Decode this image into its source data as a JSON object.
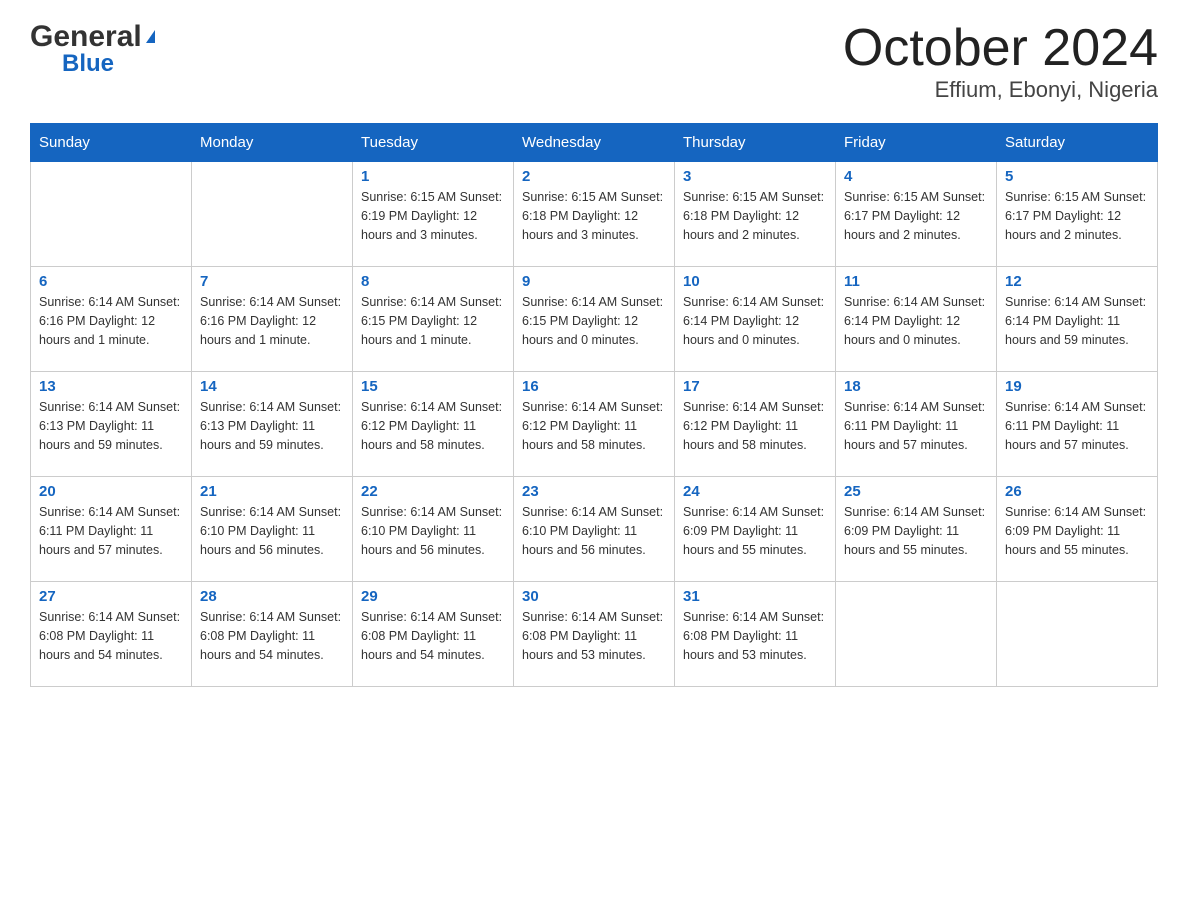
{
  "header": {
    "logo_general": "General",
    "logo_arrow": "▶",
    "logo_blue": "Blue",
    "month_title": "October 2024",
    "location": "Effium, Ebonyi, Nigeria"
  },
  "days_of_week": [
    "Sunday",
    "Monday",
    "Tuesday",
    "Wednesday",
    "Thursday",
    "Friday",
    "Saturday"
  ],
  "weeks": [
    [
      {
        "day": "",
        "info": ""
      },
      {
        "day": "",
        "info": ""
      },
      {
        "day": "1",
        "info": "Sunrise: 6:15 AM\nSunset: 6:19 PM\nDaylight: 12 hours\nand 3 minutes."
      },
      {
        "day": "2",
        "info": "Sunrise: 6:15 AM\nSunset: 6:18 PM\nDaylight: 12 hours\nand 3 minutes."
      },
      {
        "day": "3",
        "info": "Sunrise: 6:15 AM\nSunset: 6:18 PM\nDaylight: 12 hours\nand 2 minutes."
      },
      {
        "day": "4",
        "info": "Sunrise: 6:15 AM\nSunset: 6:17 PM\nDaylight: 12 hours\nand 2 minutes."
      },
      {
        "day": "5",
        "info": "Sunrise: 6:15 AM\nSunset: 6:17 PM\nDaylight: 12 hours\nand 2 minutes."
      }
    ],
    [
      {
        "day": "6",
        "info": "Sunrise: 6:14 AM\nSunset: 6:16 PM\nDaylight: 12 hours\nand 1 minute."
      },
      {
        "day": "7",
        "info": "Sunrise: 6:14 AM\nSunset: 6:16 PM\nDaylight: 12 hours\nand 1 minute."
      },
      {
        "day": "8",
        "info": "Sunrise: 6:14 AM\nSunset: 6:15 PM\nDaylight: 12 hours\nand 1 minute."
      },
      {
        "day": "9",
        "info": "Sunrise: 6:14 AM\nSunset: 6:15 PM\nDaylight: 12 hours\nand 0 minutes."
      },
      {
        "day": "10",
        "info": "Sunrise: 6:14 AM\nSunset: 6:14 PM\nDaylight: 12 hours\nand 0 minutes."
      },
      {
        "day": "11",
        "info": "Sunrise: 6:14 AM\nSunset: 6:14 PM\nDaylight: 12 hours\nand 0 minutes."
      },
      {
        "day": "12",
        "info": "Sunrise: 6:14 AM\nSunset: 6:14 PM\nDaylight: 11 hours\nand 59 minutes."
      }
    ],
    [
      {
        "day": "13",
        "info": "Sunrise: 6:14 AM\nSunset: 6:13 PM\nDaylight: 11 hours\nand 59 minutes."
      },
      {
        "day": "14",
        "info": "Sunrise: 6:14 AM\nSunset: 6:13 PM\nDaylight: 11 hours\nand 59 minutes."
      },
      {
        "day": "15",
        "info": "Sunrise: 6:14 AM\nSunset: 6:12 PM\nDaylight: 11 hours\nand 58 minutes."
      },
      {
        "day": "16",
        "info": "Sunrise: 6:14 AM\nSunset: 6:12 PM\nDaylight: 11 hours\nand 58 minutes."
      },
      {
        "day": "17",
        "info": "Sunrise: 6:14 AM\nSunset: 6:12 PM\nDaylight: 11 hours\nand 58 minutes."
      },
      {
        "day": "18",
        "info": "Sunrise: 6:14 AM\nSunset: 6:11 PM\nDaylight: 11 hours\nand 57 minutes."
      },
      {
        "day": "19",
        "info": "Sunrise: 6:14 AM\nSunset: 6:11 PM\nDaylight: 11 hours\nand 57 minutes."
      }
    ],
    [
      {
        "day": "20",
        "info": "Sunrise: 6:14 AM\nSunset: 6:11 PM\nDaylight: 11 hours\nand 57 minutes."
      },
      {
        "day": "21",
        "info": "Sunrise: 6:14 AM\nSunset: 6:10 PM\nDaylight: 11 hours\nand 56 minutes."
      },
      {
        "day": "22",
        "info": "Sunrise: 6:14 AM\nSunset: 6:10 PM\nDaylight: 11 hours\nand 56 minutes."
      },
      {
        "day": "23",
        "info": "Sunrise: 6:14 AM\nSunset: 6:10 PM\nDaylight: 11 hours\nand 56 minutes."
      },
      {
        "day": "24",
        "info": "Sunrise: 6:14 AM\nSunset: 6:09 PM\nDaylight: 11 hours\nand 55 minutes."
      },
      {
        "day": "25",
        "info": "Sunrise: 6:14 AM\nSunset: 6:09 PM\nDaylight: 11 hours\nand 55 minutes."
      },
      {
        "day": "26",
        "info": "Sunrise: 6:14 AM\nSunset: 6:09 PM\nDaylight: 11 hours\nand 55 minutes."
      }
    ],
    [
      {
        "day": "27",
        "info": "Sunrise: 6:14 AM\nSunset: 6:08 PM\nDaylight: 11 hours\nand 54 minutes."
      },
      {
        "day": "28",
        "info": "Sunrise: 6:14 AM\nSunset: 6:08 PM\nDaylight: 11 hours\nand 54 minutes."
      },
      {
        "day": "29",
        "info": "Sunrise: 6:14 AM\nSunset: 6:08 PM\nDaylight: 11 hours\nand 54 minutes."
      },
      {
        "day": "30",
        "info": "Sunrise: 6:14 AM\nSunset: 6:08 PM\nDaylight: 11 hours\nand 53 minutes."
      },
      {
        "day": "31",
        "info": "Sunrise: 6:14 AM\nSunset: 6:08 PM\nDaylight: 11 hours\nand 53 minutes."
      },
      {
        "day": "",
        "info": ""
      },
      {
        "day": "",
        "info": ""
      }
    ]
  ]
}
